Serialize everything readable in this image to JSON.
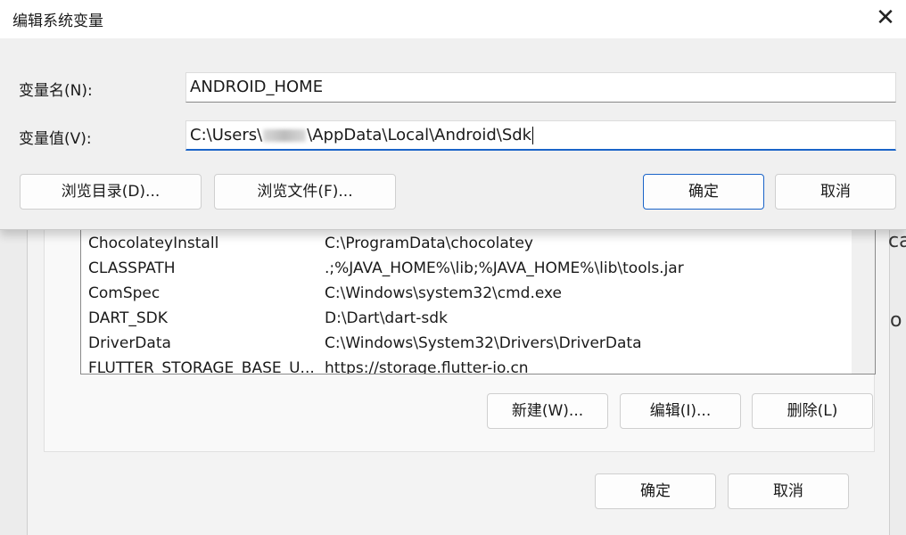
{
  "dialog": {
    "title": "编辑系统变量",
    "close_glyph": "✕",
    "name_label": "变量名(N):",
    "name_value": "ANDROID_HOME",
    "value_label": "变量值(V):",
    "value_prefix": "C:\\Users\\",
    "value_suffix": "\\AppData\\Local\\Android\\Sdk",
    "browse_dir": "浏览目录(D)...",
    "browse_file": "浏览文件(F)...",
    "ok": "确定",
    "cancel": "取消"
  },
  "system_vars": {
    "rows": [
      {
        "name": "ChocolateyInstall",
        "value": "C:\\ProgramData\\chocolatey"
      },
      {
        "name": "CLASSPATH",
        "value": ".;%JAVA_HOME%\\lib;%JAVA_HOME%\\lib\\tools.jar"
      },
      {
        "name": "ComSpec",
        "value": "C:\\Windows\\system32\\cmd.exe"
      },
      {
        "name": "DART_SDK",
        "value": "D:\\Dart\\dart-sdk"
      },
      {
        "name": "DriverData",
        "value": "C:\\Windows\\System32\\Drivers\\DriverData"
      },
      {
        "name": "FLUTTER_STORAGE_BASE_U...",
        "value": "https://storage.flutter-io.cn"
      }
    ],
    "new": "新建(W)...",
    "edit": "编辑(I)...",
    "delete": "删除(L)"
  },
  "env_window": {
    "ok": "确定",
    "cancel": "取消"
  },
  "edge": {
    "right_top": "ca",
    "right_mid": "o"
  }
}
